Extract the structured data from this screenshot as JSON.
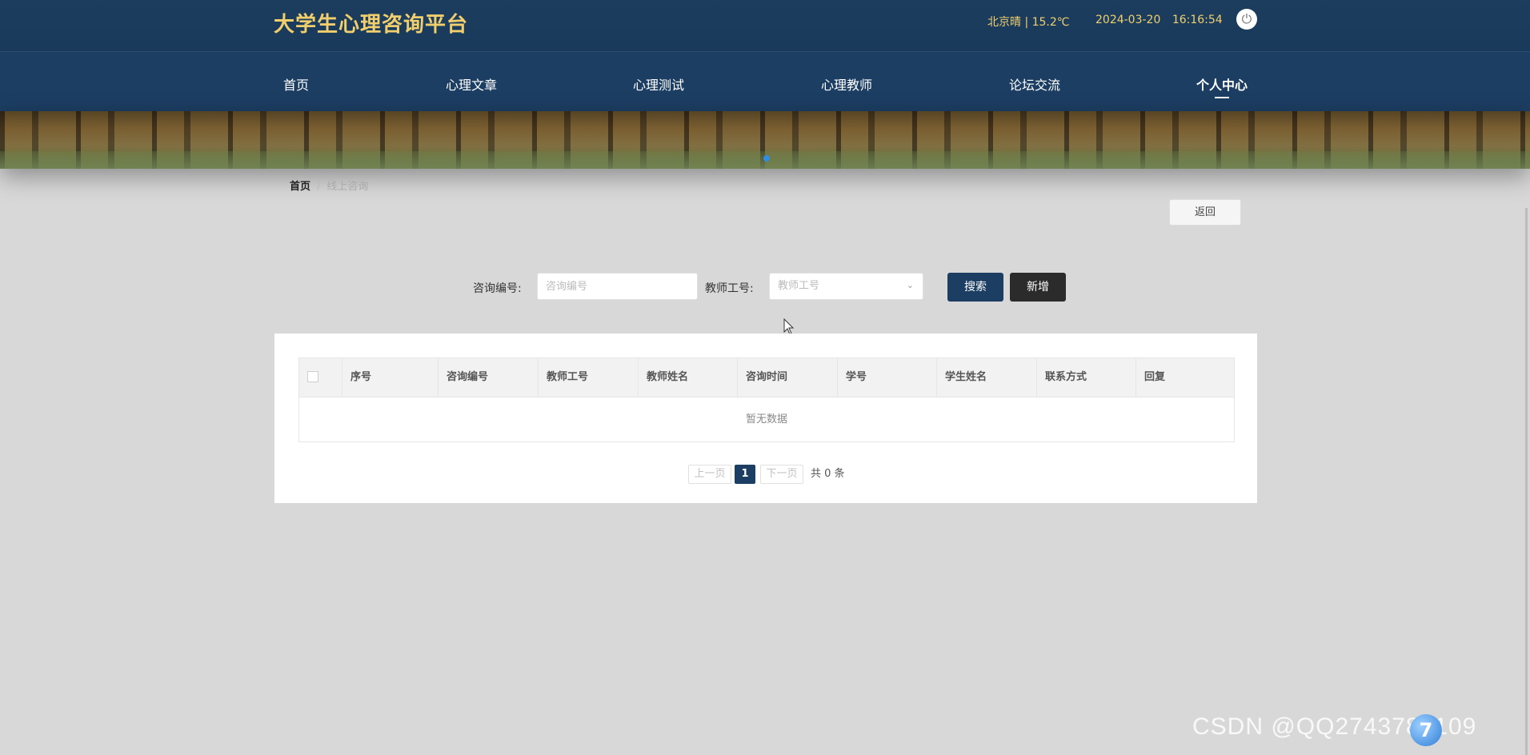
{
  "header": {
    "site_title": "大学生心理咨询平台",
    "weather": "北京晴 | 15.2℃",
    "date": "2024-03-20",
    "time": "16:16:54",
    "power_icon": "⏻"
  },
  "nav": {
    "items": [
      {
        "label": "首页"
      },
      {
        "label": "心理文章"
      },
      {
        "label": "心理测试"
      },
      {
        "label": "心理教师"
      },
      {
        "label": "论坛交流"
      },
      {
        "label": "个人中心",
        "active": true
      }
    ]
  },
  "breadcrumb": {
    "home": "首页",
    "separator": "/",
    "current": "线上咨询"
  },
  "back_button": "返回",
  "search": {
    "consult_no_label": "咨询编号:",
    "consult_no_placeholder": "咨询编号",
    "teacher_no_label": "教师工号:",
    "teacher_no_placeholder": "教师工号",
    "search_button": "搜索",
    "add_button": "新增"
  },
  "table": {
    "columns": [
      "序号",
      "咨询编号",
      "教师工号",
      "教师姓名",
      "咨询时间",
      "学号",
      "学生姓名",
      "联系方式",
      "回复"
    ],
    "rows": [],
    "empty_text": "暂无数据"
  },
  "pagination": {
    "prev": "上一页",
    "current": "1",
    "next": "下一页",
    "total": "共 0 条"
  },
  "watermark": {
    "text": "CSDN @QQ2743785109",
    "badge": "7"
  },
  "colors": {
    "primary": "#1c3e62",
    "title_gold": "#f0cf6c",
    "add_button": "#2b2b2b",
    "page_bg": "#d8d8d8"
  }
}
